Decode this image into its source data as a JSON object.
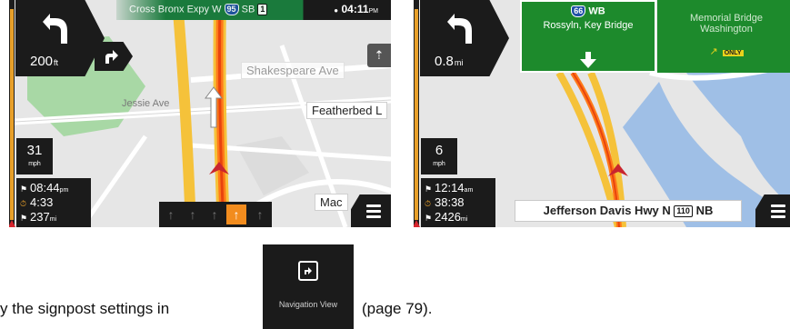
{
  "screen1": {
    "turn_distance": "200",
    "turn_distance_unit": "ft",
    "street_name": "Cross Bronx Expy W",
    "shield_route": "95",
    "direction": "SB",
    "exit_badge": "1",
    "clock": "04:11",
    "clock_suffix": "PM",
    "speed": "31",
    "speed_unit": "mph",
    "arrival_time": "08:44",
    "arrival_suffix": "pm",
    "trip_duration": "4:33",
    "trip_distance": "237",
    "trip_distance_unit": "mi",
    "map_labels": {
      "shakespeare": "Shakespeare Ave",
      "featherbed": "Featherbed L",
      "macombs": "Mac",
      "park": "Jessie Ave"
    }
  },
  "screen2": {
    "turn_distance": "0.8",
    "turn_distance_unit": "mi",
    "sign_route": "66",
    "sign_direction": "WB",
    "sign_destination": "Rossyln, Key Bridge",
    "sign2_line1": "Memorial Bridge",
    "sign2_line2": "Washington",
    "only_badge": "ONLY",
    "speed": "6",
    "speed_unit": "mph",
    "arrival_time": "12:14",
    "arrival_suffix": "am",
    "trip_duration": "38:38",
    "trip_distance": "2426",
    "trip_distance_unit": "mi",
    "current_street": "Jefferson Davis Hwy N",
    "current_street_route": "110",
    "current_street_dir": "NB"
  },
  "icon_label": "Navigation View",
  "caption_before": "y the signpost settings in",
  "caption_after": "(page 79)."
}
